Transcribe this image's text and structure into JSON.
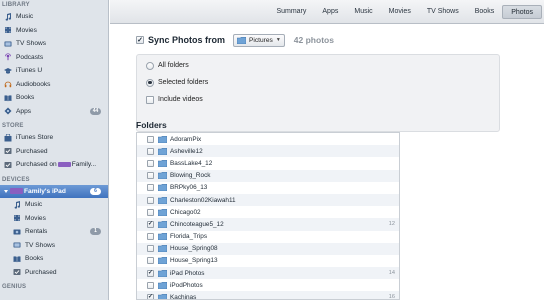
{
  "sidebar": {
    "library_header": "LIBRARY",
    "library": [
      {
        "label": "Music",
        "icon": "music-note-icon"
      },
      {
        "label": "Movies",
        "icon": "film-icon"
      },
      {
        "label": "TV Shows",
        "icon": "tv-icon"
      },
      {
        "label": "Podcasts",
        "icon": "podcast-icon"
      },
      {
        "label": "iTunes U",
        "icon": "graduation-cap-icon"
      },
      {
        "label": "Audiobooks",
        "icon": "audiobook-icon"
      },
      {
        "label": "Books",
        "icon": "book-icon"
      },
      {
        "label": "Apps",
        "icon": "apps-icon",
        "badge": "44"
      }
    ],
    "store_header": "STORE",
    "store": [
      {
        "label": "iTunes Store",
        "icon": "store-icon"
      },
      {
        "label": "Purchased",
        "icon": "purchased-icon"
      },
      {
        "label_prefix": "Purchased on",
        "label_suffix": "Family...",
        "icon": "purchased-icon"
      }
    ],
    "devices_header": "DEVICES",
    "device": {
      "label": "Family's iPad",
      "icon": "ipad-icon",
      "badge": "6"
    },
    "device_items": [
      {
        "label": "Music",
        "icon": "music-note-icon"
      },
      {
        "label": "Movies",
        "icon": "film-icon"
      },
      {
        "label": "Rentals",
        "icon": "rentals-icon",
        "badge": "1"
      },
      {
        "label": "TV Shows",
        "icon": "tv-icon"
      },
      {
        "label": "Books",
        "icon": "book-icon"
      },
      {
        "label": "Purchased",
        "icon": "purchased-icon"
      }
    ],
    "genius_header": "GENIUS"
  },
  "tabs": [
    {
      "label": "Summary",
      "active": false
    },
    {
      "label": "Apps",
      "active": false
    },
    {
      "label": "Music",
      "active": false
    },
    {
      "label": "Movies",
      "active": false
    },
    {
      "label": "TV Shows",
      "active": false
    },
    {
      "label": "Books",
      "active": false
    },
    {
      "label": "Photos",
      "active": true
    }
  ],
  "sync": {
    "checked": true,
    "label": "Sync Photos from",
    "source": "Pictures",
    "count": "42 photos"
  },
  "options": [
    {
      "type": "radio",
      "label": "All folders",
      "selected": false
    },
    {
      "type": "radio",
      "label": "Selected folders",
      "selected": true
    },
    {
      "type": "checkbox",
      "label": "Include videos",
      "checked": false
    }
  ],
  "folders_header": "Folders",
  "folders": [
    {
      "name": "AdoramPix",
      "checked": false,
      "count": ""
    },
    {
      "name": "Asheville12",
      "checked": false,
      "count": ""
    },
    {
      "name": "BassLake4_12",
      "checked": false,
      "count": ""
    },
    {
      "name": "Blowing_Rock",
      "checked": false,
      "count": ""
    },
    {
      "name": "BRPky06_13",
      "checked": false,
      "count": ""
    },
    {
      "name": "Charleston02Kiawah11",
      "checked": false,
      "count": ""
    },
    {
      "name": "Chicago02",
      "checked": false,
      "count": ""
    },
    {
      "name": "Chincoteague5_12",
      "checked": true,
      "count": "12"
    },
    {
      "name": "Florida_Trips",
      "checked": false,
      "count": ""
    },
    {
      "name": "House_Spring08",
      "checked": false,
      "count": ""
    },
    {
      "name": "House_Spring13",
      "checked": false,
      "count": ""
    },
    {
      "name": "iPad Photos",
      "checked": true,
      "count": "14"
    },
    {
      "name": "iPodPhotos",
      "checked": false,
      "count": ""
    },
    {
      "name": "Kachinas",
      "checked": true,
      "count": "16"
    }
  ],
  "colors": {
    "sidebar_bg": "#dfe4ea",
    "selection": "#3f72be",
    "folder_blue": "#6fa3d6",
    "device_swatch": "#8a5fc0"
  }
}
